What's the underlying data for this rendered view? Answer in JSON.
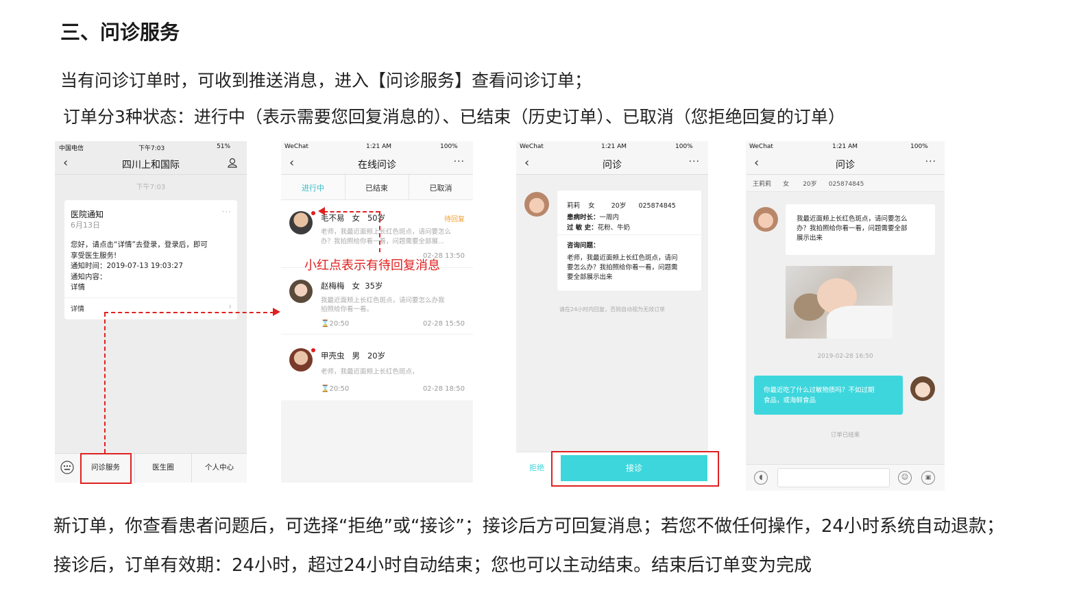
{
  "heading": "三、问诊服务",
  "intro_lines": [
    "当有问诊订单时，可收到推送消息，进入【问诊服务】查看问诊订单；",
    "订单分3种状态：进行中（表示需要您回复消息的）、已结束（历史订单）、已取消（您拒绝回复的订单）"
  ],
  "footer_lines": [
    "新订单，你查看患者问题后，可选择“拒绝”或“接诊”；接诊后方可回复消息；若您不做任何操作，24小时系统自动退款；",
    "接诊后，订单有效期：24小时，超过24小时自动结束；您也可以主动结束。结束后订单变为完成"
  ],
  "annotation": "小红点表示有待回复消息",
  "phone1": {
    "carrier": "中国电信",
    "time": "下午7:03",
    "battery": "51%",
    "title": "四川上和国际",
    "timestamp": "下午7:03",
    "card": {
      "title": "医院通知",
      "date": "6月13日",
      "lines": [
        "您好，请点击“详情”去登录，登录后，即可",
        "享受医生服务!",
        "通知时间：2019-07-13 19:03:27",
        "通知内容：",
        "详情"
      ],
      "detail_link": "详情"
    },
    "tabs": [
      "问诊服务",
      "医生圈",
      "个人中心"
    ]
  },
  "phone2": {
    "carrier": "WeChat",
    "time": "1:21 AM",
    "battery": "100%",
    "title": "在线问诊",
    "tabs": [
      "进行中",
      "已结束",
      "已取消"
    ],
    "items": [
      {
        "name": "毛不易",
        "sex": "女",
        "age": "50岁",
        "status": "待回复",
        "msg1": "老师，我最近面颊上长红色斑点，请问要怎么",
        "msg2": "办？我拍照给你看一看，问题需要全部展...",
        "left": "",
        "right": "02-28  13:50"
      },
      {
        "name": "赵梅梅",
        "sex": "女",
        "age": "35岁",
        "status": "",
        "msg1": "我最近面颊上长红色斑点，请问要怎么办我",
        "msg2": "拍照给你看一看。",
        "left": "20:50",
        "right": "02-28  15:50"
      },
      {
        "name": "甲壳虫",
        "sex": "男",
        "age": "20岁",
        "status": "",
        "msg1": "老师，我最近面颊上长红色斑点，",
        "msg2": "",
        "left": "20:50",
        "right": "02-28  18:50"
      }
    ]
  },
  "phone3": {
    "carrier": "WeChat",
    "time": "1:21 AM",
    "battery": "100%",
    "title": "问诊",
    "patient_line": "莉莉    女        20岁      025874845",
    "duration_label": "患病时长：",
    "duration_value": "一周内",
    "allergy_label": "过 敏 史：",
    "allergy_value": "花粉、牛奶",
    "question_label": "咨询问题：",
    "question_lines": [
      "老师，我最近面颊上长红色斑点，请问",
      "要怎么办？我拍照给你看一看，问题需",
      "要全部展示出来"
    ],
    "notice": "请在24小时内回复，否则自动视为无效订单",
    "reject": "拒绝",
    "accept": "接诊"
  },
  "phone4": {
    "carrier": "WeChat",
    "time": "1:21 AM",
    "battery": "100%",
    "title": "问诊",
    "subheader": "王莉莉      女       20岁      025874845",
    "patient_msg": [
      "我最近面颊上长红色斑点，请问要怎么",
      "办？我拍照给你看一看，问题需要全部",
      "展示出来"
    ],
    "timestamp": "2019-02-28  16:50",
    "doctor_msg": [
      "你最近吃了什么过敏物质吗？不如过期",
      "食品，或海鲜食品"
    ],
    "ended": "订单已结束"
  },
  "colors": {
    "accent": "#3dd6dc",
    "red": "#e02020",
    "tab_active": "#2fbfc7"
  }
}
